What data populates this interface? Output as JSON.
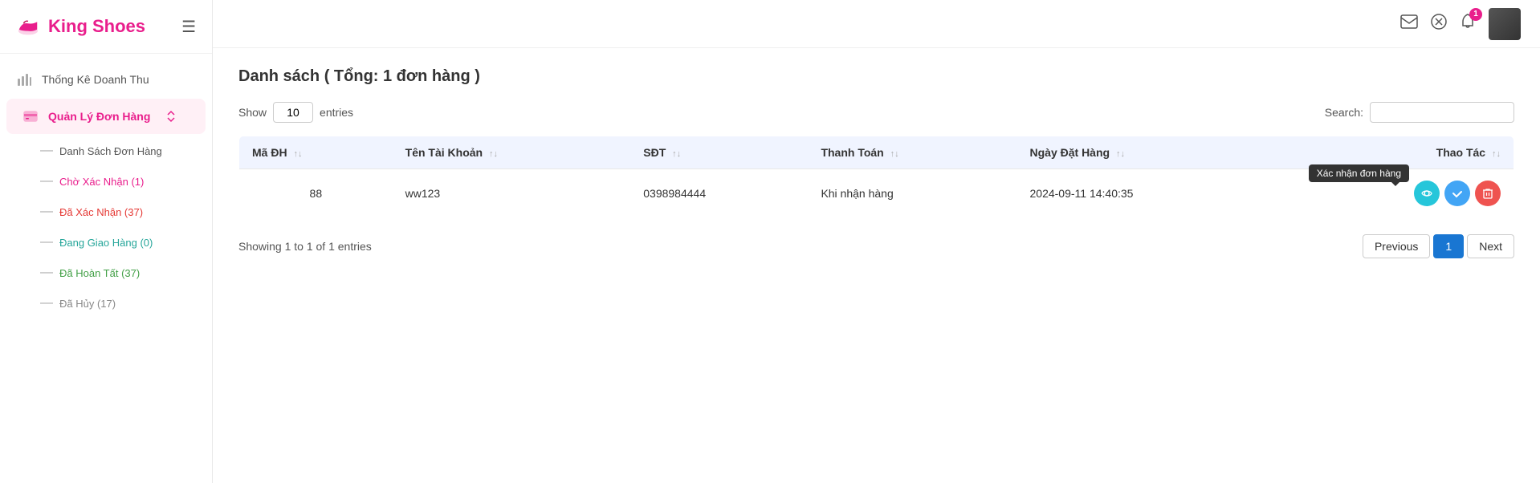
{
  "app": {
    "name": "King Shoes",
    "logo_alt": "shoe-icon"
  },
  "sidebar": {
    "items": [
      {
        "id": "revenue",
        "label": "Thống Kê Doanh Thu",
        "icon": "chart-icon",
        "active": false
      },
      {
        "id": "orders",
        "label": "Quản Lý Đơn Hàng",
        "icon": "card-icon",
        "active": true
      }
    ],
    "sub_items": [
      {
        "id": "all-orders",
        "label": "Danh Sách Đơn Hàng",
        "style": "normal"
      },
      {
        "id": "pending",
        "label": "Chờ Xác Nhận (1)",
        "style": "pink"
      },
      {
        "id": "confirmed",
        "label": "Đã Xác Nhận (37)",
        "style": "red"
      },
      {
        "id": "delivering",
        "label": "Đang Giao Hàng (0)",
        "style": "teal"
      },
      {
        "id": "done",
        "label": "Đã Hoàn Tất (37)",
        "style": "green"
      },
      {
        "id": "cancelled",
        "label": "Đã Hủy (17)",
        "style": "gray"
      }
    ]
  },
  "topbar": {
    "mail_icon": "mail-icon",
    "close_icon": "close-icon",
    "bell_icon": "bell-icon",
    "bell_badge": "1",
    "avatar_alt": "user-avatar"
  },
  "page": {
    "title": "Danh sách ( Tổng: 1 đơn hàng )"
  },
  "table_controls": {
    "show_label": "Show",
    "show_value": "10",
    "entries_label": "entries",
    "search_label": "Search:",
    "search_placeholder": ""
  },
  "table": {
    "columns": [
      {
        "id": "order-id",
        "label": "Mã ĐH",
        "sortable": true
      },
      {
        "id": "account",
        "label": "Tên Tài Khoản",
        "sortable": true
      },
      {
        "id": "phone",
        "label": "SĐT",
        "sortable": true
      },
      {
        "id": "payment",
        "label": "Thanh Toán",
        "sortable": true
      },
      {
        "id": "date",
        "label": "Ngày Đặt Hàng",
        "sortable": true
      },
      {
        "id": "action",
        "label": "Thao Tác",
        "sortable": true
      }
    ],
    "rows": [
      {
        "order_id": "88",
        "account": "ww123",
        "phone": "0398984444",
        "payment": "Khi nhận hàng",
        "date": "2024-09-11 14:40:35"
      }
    ]
  },
  "tooltip": {
    "approve_label": "Xác nhận đơn hàng"
  },
  "pagination": {
    "showing_text": "Showing 1 to 1 of 1 entries",
    "previous_label": "Previous",
    "next_label": "Next",
    "current_page": "1"
  }
}
